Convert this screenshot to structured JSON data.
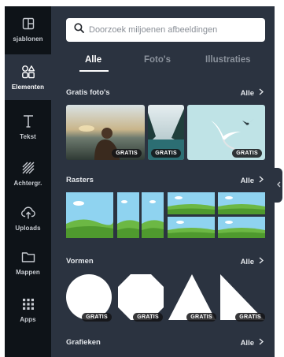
{
  "rail": {
    "items": [
      {
        "label": "sjablonen",
        "icon": "templates-icon"
      },
      {
        "label": "Elementen",
        "icon": "elements-icon"
      },
      {
        "label": "Tekst",
        "icon": "text-icon"
      },
      {
        "label": "Achtergr.",
        "icon": "background-icon"
      },
      {
        "label": "Uploads",
        "icon": "upload-icon"
      },
      {
        "label": "Mappen",
        "icon": "folder-icon"
      },
      {
        "label": "Apps",
        "icon": "apps-icon"
      }
    ]
  },
  "search": {
    "placeholder": "Doorzoek miljoenen afbeeldingen"
  },
  "tabs": [
    "Alle",
    "Foto's",
    "Illustraties"
  ],
  "sections": {
    "photos": {
      "title": "Gratis foto's",
      "all": "Alle"
    },
    "grids": {
      "title": "Rasters",
      "all": "Alle"
    },
    "shapes": {
      "title": "Vormen",
      "all": "Alle"
    },
    "charts": {
      "title": "Grafieken",
      "all": "Alle"
    }
  },
  "badge": "GRATIS",
  "colors": {
    "rail_bg": "#0e1318",
    "panel_bg": "#2b3340",
    "accent_text": "#ffffff"
  }
}
